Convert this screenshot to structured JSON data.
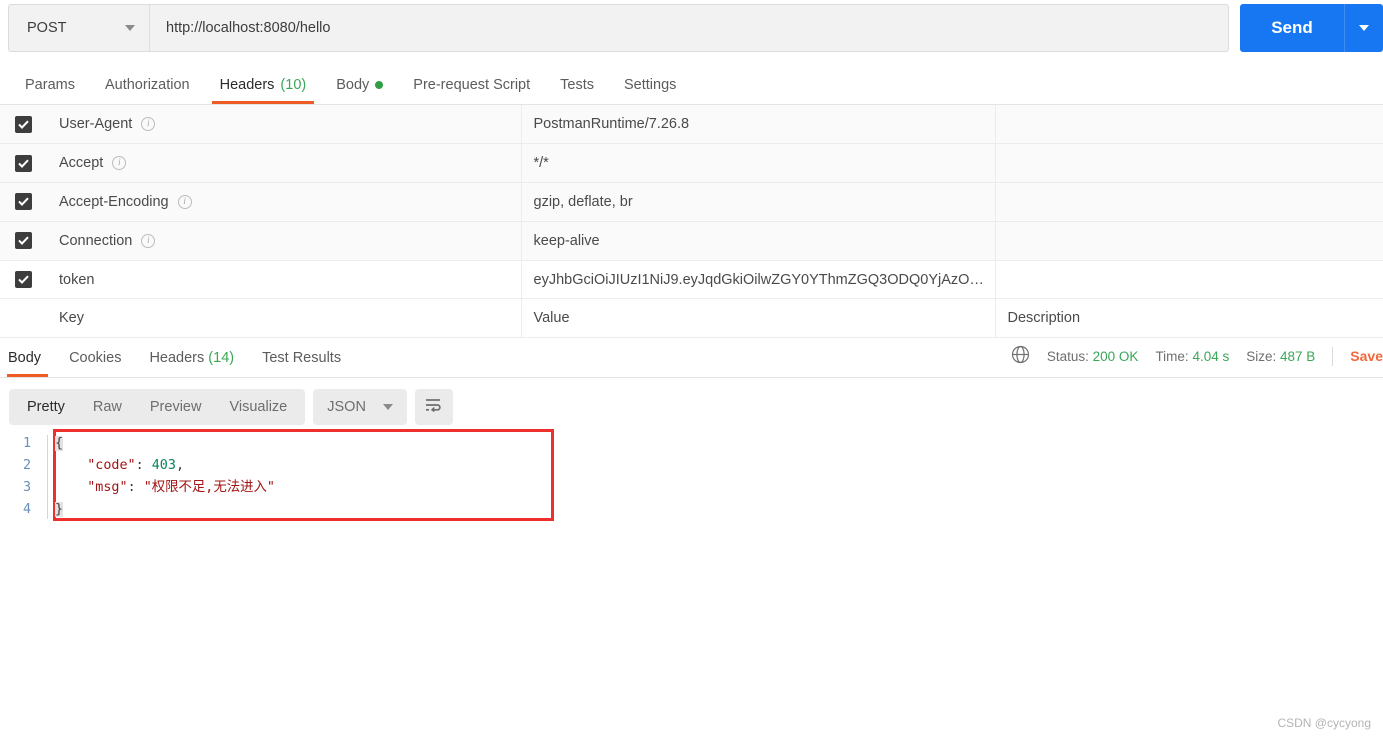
{
  "request": {
    "method": "POST",
    "url": "http://localhost:8080/hello",
    "send_label": "Send",
    "tabs": [
      {
        "label": "Params",
        "count": "",
        "dot": false,
        "active": false
      },
      {
        "label": "Authorization",
        "count": "",
        "dot": false,
        "active": false
      },
      {
        "label": "Headers",
        "count": "(10)",
        "dot": false,
        "active": true
      },
      {
        "label": "Body",
        "count": "",
        "dot": true,
        "active": false
      },
      {
        "label": "Pre-request Script",
        "count": "",
        "dot": false,
        "active": false
      },
      {
        "label": "Tests",
        "count": "",
        "dot": false,
        "active": false
      },
      {
        "label": "Settings",
        "count": "",
        "dot": false,
        "active": false
      }
    ]
  },
  "headers_table": {
    "placeholders": {
      "key": "Key",
      "value": "Value",
      "description": "Description"
    },
    "rows": [
      {
        "checked": true,
        "key": "User-Agent",
        "info": true,
        "value": "PostmanRuntime/7.26.8",
        "description": ""
      },
      {
        "checked": true,
        "key": "Accept",
        "info": true,
        "value": "*/*",
        "description": ""
      },
      {
        "checked": true,
        "key": "Accept-Encoding",
        "info": true,
        "value": "gzip, deflate, br",
        "description": ""
      },
      {
        "checked": true,
        "key": "Connection",
        "info": true,
        "value": "keep-alive",
        "description": ""
      },
      {
        "checked": true,
        "key": "token",
        "info": false,
        "value": "eyJhbGciOiJIUzI1NiJ9.eyJqdGkiOilwZGY0YThmZGQ3ODQ0YjAzO…",
        "description": ""
      }
    ]
  },
  "response": {
    "tabs": [
      {
        "label": "Body",
        "count": "",
        "active": true
      },
      {
        "label": "Cookies",
        "count": "",
        "active": false
      },
      {
        "label": "Headers",
        "count": "(14)",
        "active": false
      },
      {
        "label": "Test Results",
        "count": "",
        "active": false
      }
    ],
    "meta": {
      "status_label": "Status:",
      "status_value": "200 OK",
      "time_label": "Time:",
      "time_value": "4.04 s",
      "size_label": "Size:",
      "size_value": "487 B",
      "save_label": "Save"
    },
    "viewer": {
      "modes": [
        "Pretty",
        "Raw",
        "Preview",
        "Visualize"
      ],
      "active_mode": "Pretty",
      "format": "JSON"
    },
    "body": {
      "line_numbers": [
        "1",
        "2",
        "3",
        "4"
      ],
      "line1_brace": "{",
      "line2_key": "\"code\"",
      "line2_colon": ": ",
      "line2_value": "403",
      "line2_comma": ",",
      "line3_key": "\"msg\"",
      "line3_colon": ": ",
      "line3_value": "\"权限不足,无法进入\"",
      "line4_brace": "}",
      "indent": "    "
    }
  },
  "watermark": "CSDN @cycyong",
  "colors": {
    "accent_orange": "#ef5b25",
    "send_blue": "#1777f2",
    "green": "#3aa757",
    "highlight_red": "#ef2e2e"
  }
}
